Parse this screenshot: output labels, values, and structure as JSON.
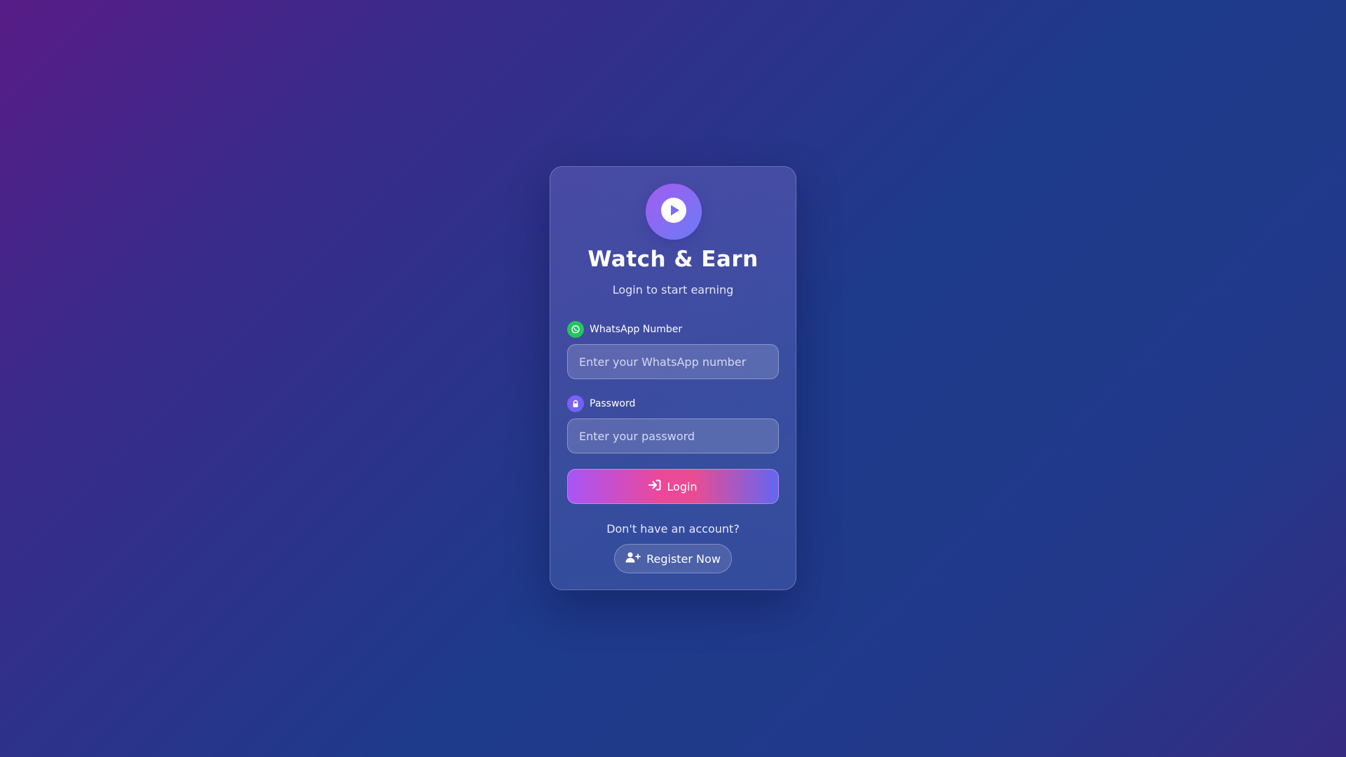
{
  "app": {
    "title": "Watch & Earn",
    "subtitle": "Login to start earning",
    "logo_icon": "play-circle-icon"
  },
  "form": {
    "whatsapp": {
      "label": "WhatsApp Number",
      "placeholder": "Enter your WhatsApp number",
      "value": "",
      "icon": "whatsapp-icon"
    },
    "password": {
      "label": "Password",
      "placeholder": "Enter your password",
      "value": "",
      "icon": "lock-icon"
    },
    "login_button": {
      "label": "Login",
      "icon": "sign-in-icon"
    }
  },
  "footer": {
    "prompt": "Don't have an account?",
    "register_button": {
      "label": "Register Now",
      "icon": "user-plus-icon"
    }
  },
  "colors": {
    "whatsapp_green": "#22c55e",
    "accent_purple": "#a855f7",
    "accent_pink": "#ec4899",
    "accent_indigo": "#6366f1"
  }
}
